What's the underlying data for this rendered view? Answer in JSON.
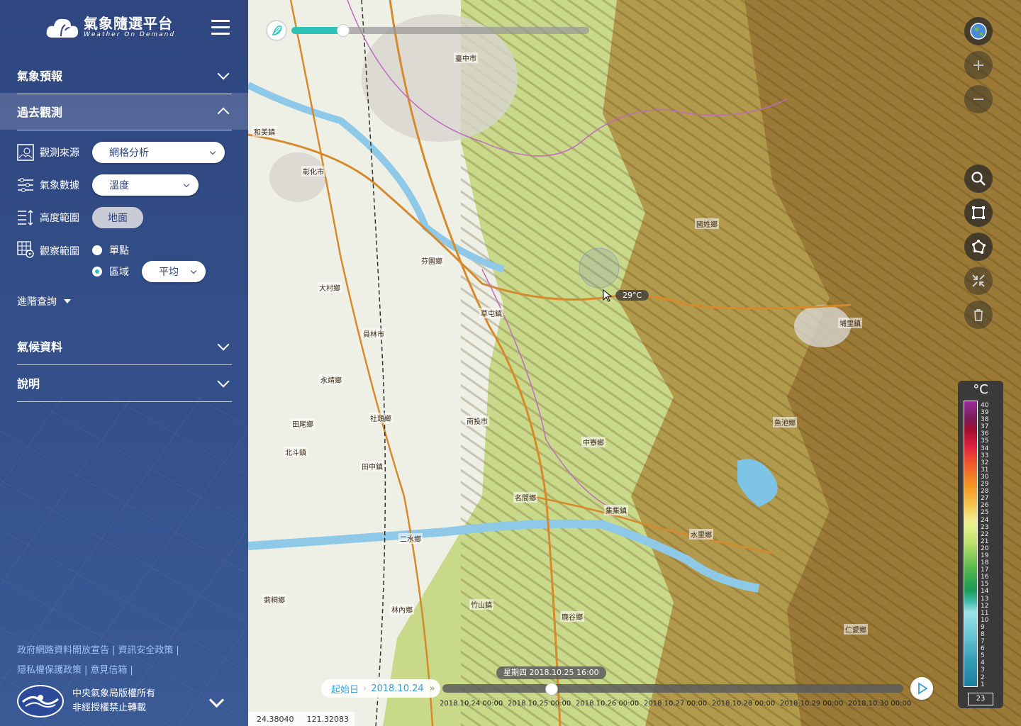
{
  "brand": {
    "title_zh": "氣象隨選平台",
    "title_en": "Weather On Demand"
  },
  "sidebar": {
    "sections": [
      {
        "label": "氣象預報"
      },
      {
        "label": "過去觀測"
      },
      {
        "label": "氣候資料"
      },
      {
        "label": "說明"
      }
    ],
    "obs_source": {
      "label": "觀測來源",
      "value": "網格分析"
    },
    "obs_data": {
      "label": "氣象數據",
      "value": "溫度"
    },
    "altitude": {
      "label": "高度範圍",
      "value": "地面"
    },
    "area": {
      "label": "觀察範圍",
      "opt_point": "單點",
      "opt_region": "區域",
      "agg": "平均"
    },
    "advanced": "進階查詢"
  },
  "footer": {
    "links": [
      "政府網路資料開放宣告",
      "資訊安全政策",
      "隱私權保護政策",
      "意見信箱"
    ],
    "copyright": "中央氣象局版權所有",
    "notice": "非經授權禁止轉載"
  },
  "map": {
    "probe": "29°C",
    "coords": {
      "lat": "24.38040",
      "lon": "121.32083"
    },
    "places": [
      "臺中市",
      "彰化市",
      "和美鎮",
      "大村鄉",
      "員林市",
      "芬園鄉",
      "草屯鎮",
      "南投市",
      "埔里鎮",
      "國姓鄉",
      "中寮鄉",
      "集集鎮",
      "水里鄉",
      "竹山鎮",
      "名間鄉",
      "田中鎮",
      "社頭鄉",
      "田尾鄉",
      "北斗鎮",
      "永靖鄉",
      "林內鄉",
      "莿桐鄉",
      "二水鄉",
      "魚池鄉",
      "鹿谷鄉",
      "仁愛鄉"
    ]
  },
  "legend": {
    "unit": "°C",
    "ticks": [
      "40",
      "39",
      "38",
      "37",
      "36",
      "35",
      "34",
      "33",
      "32",
      "31",
      "30",
      "29",
      "28",
      "27",
      "26",
      "25",
      "24",
      "23",
      "22",
      "21",
      "20",
      "19",
      "18",
      "17",
      "16",
      "15",
      "14",
      "13",
      "12",
      "11",
      "10",
      "9",
      "8",
      "7",
      "6",
      "5",
      "4",
      "3",
      "2",
      "1"
    ],
    "current": "23"
  },
  "timeline": {
    "start_label": "起始日",
    "start_date": "2018.10.24",
    "tooltip": "星期四 2018.10.25 16:00",
    "dates": [
      "2018.10.24 00:00",
      "2018.10.25 00:00",
      "2018.10.26 00:00",
      "2018.10.27 00:00",
      "2018.10.28 00:00",
      "2018.10.29 00:00",
      "2018.10.30 00:00"
    ]
  },
  "colors": {
    "sidebar": "#2f4680",
    "accent": "#2ec2b8",
    "link": "#9fc3ff"
  }
}
